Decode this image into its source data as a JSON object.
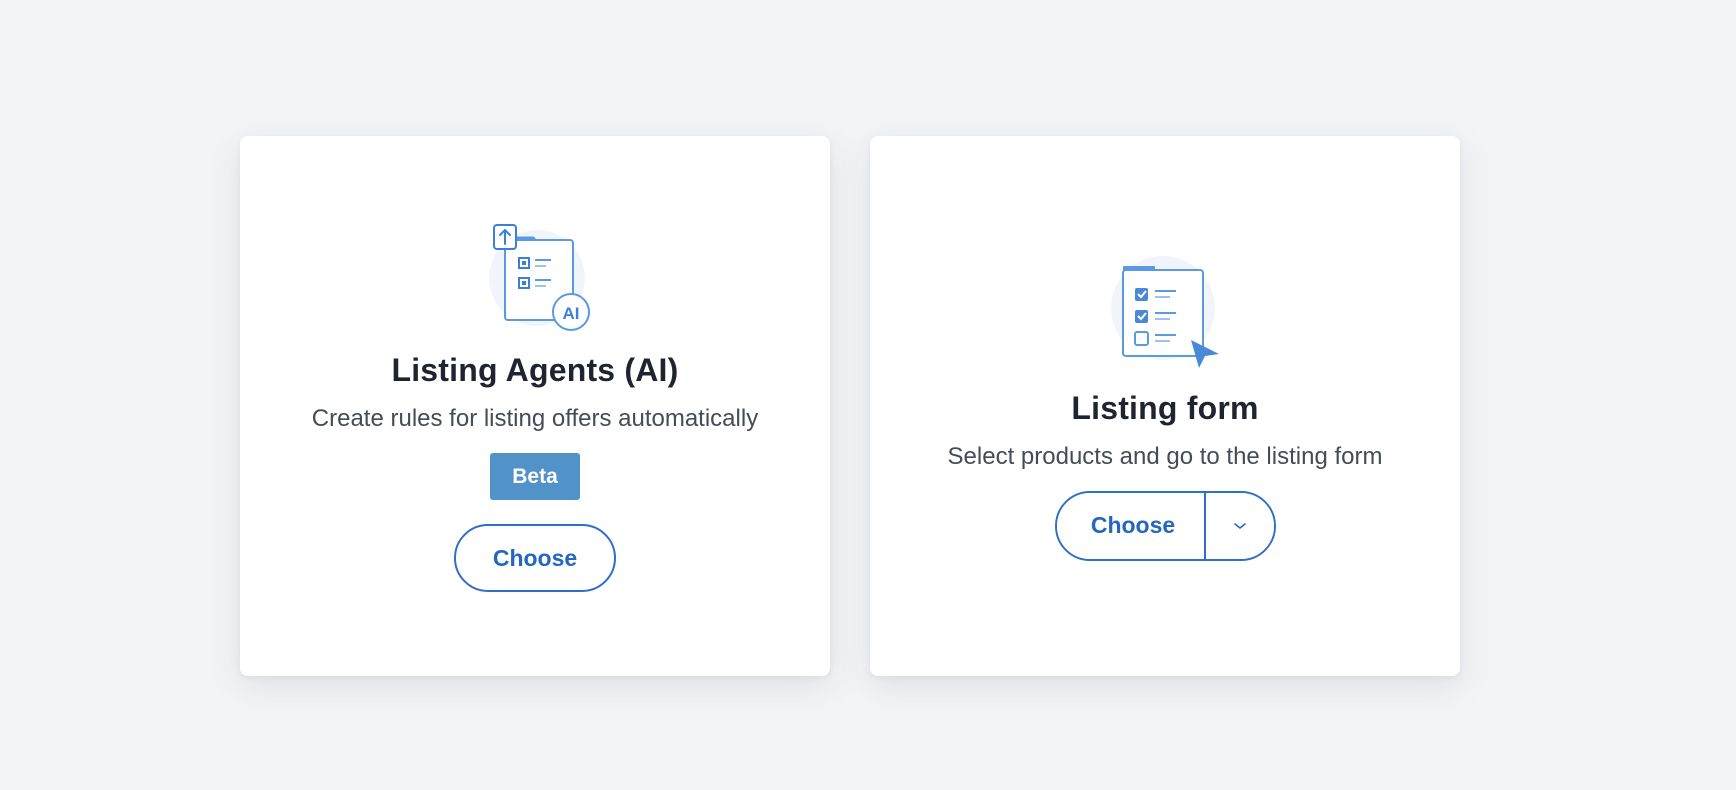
{
  "cards": [
    {
      "title": "Listing Agents (AI)",
      "description": "Create rules for listing offers automatically",
      "badge": "Beta",
      "button_label": "Choose",
      "icon": "ai-agent-checklist-icon"
    },
    {
      "title": "Listing form",
      "description": "Select products and go to the listing form",
      "button_label": "Choose",
      "dropdown_icon": "chevron-down-icon",
      "icon": "listing-form-checklist-icon"
    }
  ],
  "ai_badge_text": "AI",
  "colors": {
    "background": "#f3f4f6",
    "card": "#ffffff",
    "accent": "#2f6fc6",
    "badge": "#5192c9",
    "illustration_stroke": "#5a9ae0",
    "illustration_fill": "#eef4fc"
  }
}
